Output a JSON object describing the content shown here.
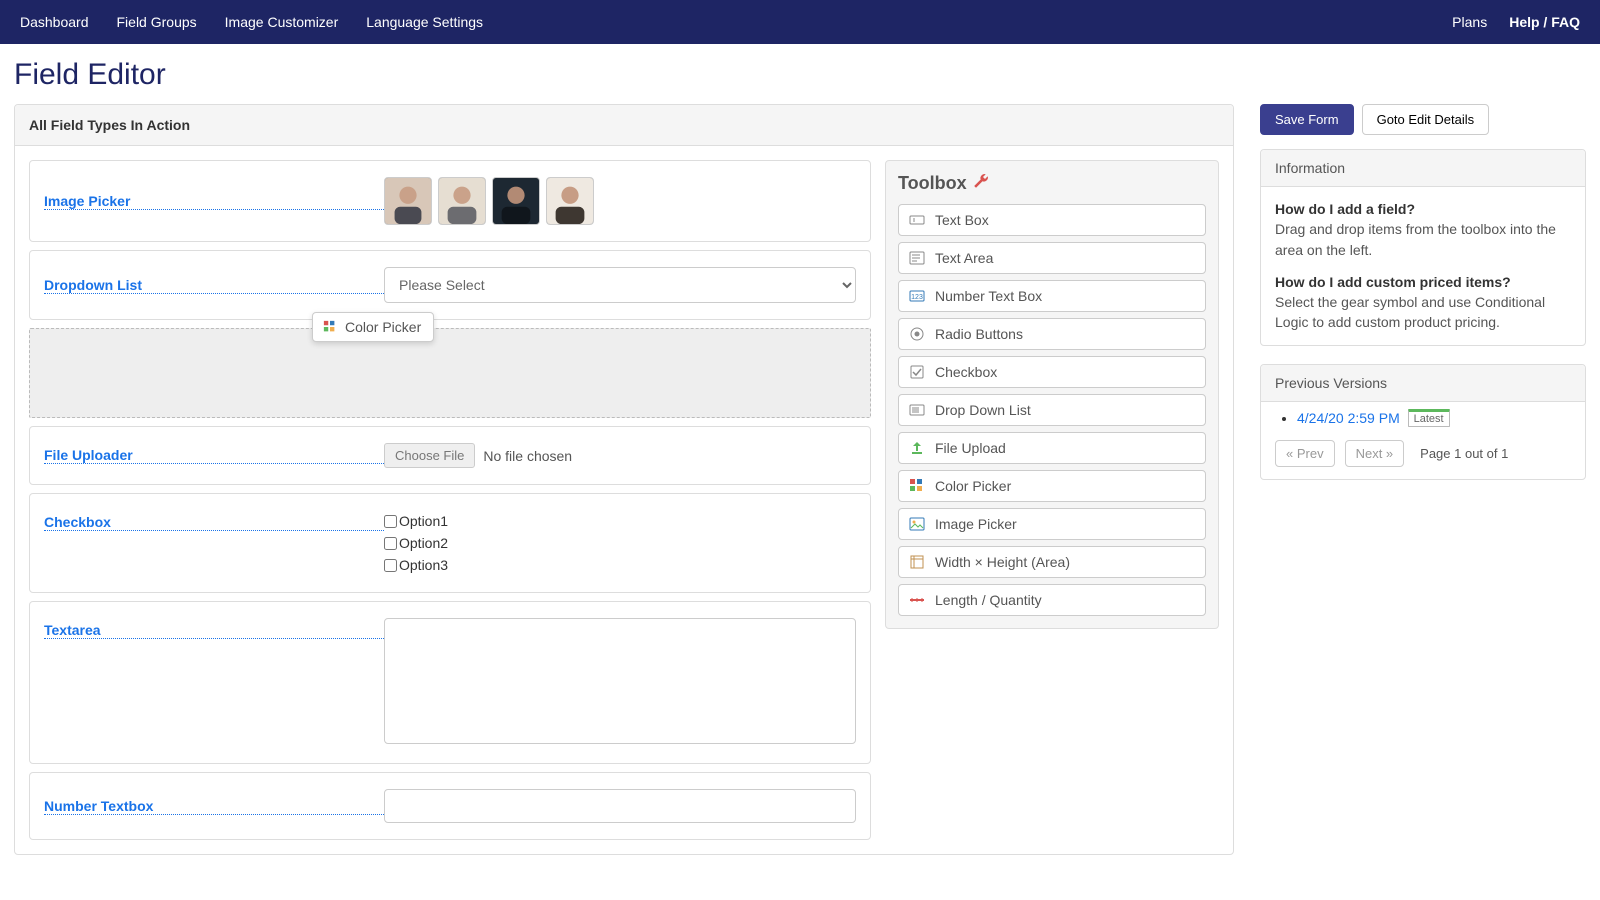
{
  "nav": {
    "left": [
      "Dashboard",
      "Field Groups",
      "Image Customizer",
      "Language Settings"
    ],
    "right": [
      "Plans",
      "Help / FAQ"
    ]
  },
  "page_title": "Field Editor",
  "editor_header": "All Field Types In Action",
  "fields": {
    "image_picker": {
      "label": "Image Picker"
    },
    "dropdown": {
      "label": "Dropdown List",
      "placeholder": "Please Select"
    },
    "file_uploader": {
      "label": "File Uploader",
      "button": "Choose File",
      "status": "No file chosen"
    },
    "checkbox": {
      "label": "Checkbox",
      "options": [
        "Option1",
        "Option2",
        "Option3"
      ]
    },
    "textarea": {
      "label": "Textarea"
    },
    "number": {
      "label": "Number Textbox"
    }
  },
  "drag_chip": {
    "label": "Color Picker"
  },
  "toolbox": {
    "title": "Toolbox",
    "items": [
      "Text Box",
      "Text Area",
      "Number Text Box",
      "Radio Buttons",
      "Checkbox",
      "Drop Down List",
      "File Upload",
      "Color Picker",
      "Image Picker",
      "Width × Height (Area)",
      "Length / Quantity"
    ]
  },
  "actions": {
    "save": "Save Form",
    "goto": "Goto Edit Details"
  },
  "info": {
    "title": "Information",
    "q1": "How do I add a field?",
    "a1": "Drag and drop items from the toolbox into the area on the left.",
    "q2": "How do I add custom priced items?",
    "a2": "Select the gear symbol and use Conditional Logic to add custom product pricing."
  },
  "versions": {
    "title": "Previous Versions",
    "entry": "4/24/20 2:59 PM",
    "badge": "Latest",
    "prev": "« Prev",
    "next": "Next »",
    "page_text": "Page 1 out of 1"
  }
}
